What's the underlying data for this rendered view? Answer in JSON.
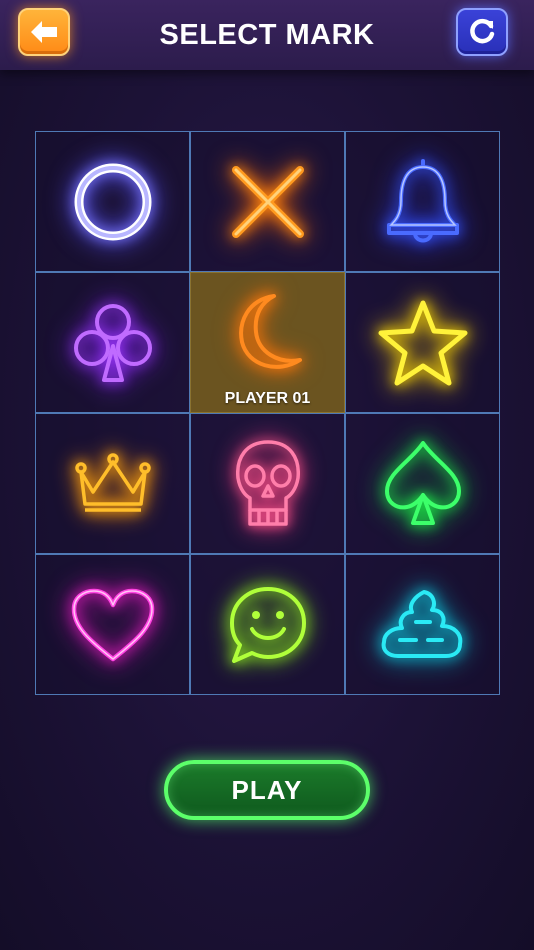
{
  "header": {
    "title": "SELECT MARK",
    "back_icon": "arrow-left-icon",
    "refresh_icon": "refresh-icon"
  },
  "marks": [
    {
      "name": "circle",
      "icon": "circle-icon",
      "color": "#8f8bff",
      "selected": false
    },
    {
      "name": "cross",
      "icon": "cross-icon",
      "color": "#ff9a1f",
      "selected": false
    },
    {
      "name": "bell",
      "icon": "bell-icon",
      "color": "#3b5bff",
      "selected": false
    },
    {
      "name": "club",
      "icon": "club-icon",
      "color": "#b04bff",
      "selected": false
    },
    {
      "name": "moon",
      "icon": "moon-icon",
      "color": "#ff8a1f",
      "selected": true,
      "label": "PLAYER 01"
    },
    {
      "name": "star",
      "icon": "star-icon",
      "color": "#ffe81f",
      "selected": false
    },
    {
      "name": "crown",
      "icon": "crown-icon",
      "color": "#ffb21f",
      "selected": false
    },
    {
      "name": "skull",
      "icon": "skull-icon",
      "color": "#ff6e9e",
      "selected": false
    },
    {
      "name": "spade",
      "icon": "spade-icon",
      "color": "#2cff5a",
      "selected": false
    },
    {
      "name": "heart",
      "icon": "heart-icon",
      "color": "#ff2ed9",
      "selected": false
    },
    {
      "name": "smiley",
      "icon": "smiley-chat-icon",
      "color": "#a8ff2e",
      "selected": false
    },
    {
      "name": "poop",
      "icon": "poop-icon",
      "color": "#22e6f0",
      "selected": false
    }
  ],
  "play_button": {
    "label": "PLAY",
    "color": "#5cff6a"
  }
}
